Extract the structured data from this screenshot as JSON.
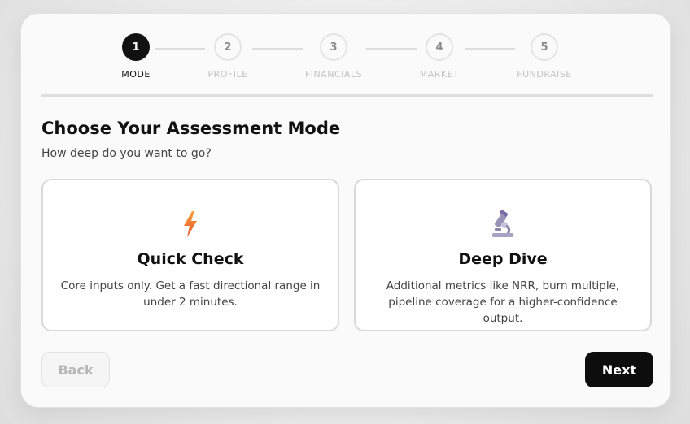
{
  "stepper": {
    "steps": [
      {
        "number": "1",
        "label": "MODE",
        "state": "active"
      },
      {
        "number": "2",
        "label": "PROFILE",
        "state": "inactive"
      },
      {
        "number": "3",
        "label": "FINANCIALS",
        "state": "inactive"
      },
      {
        "number": "4",
        "label": "MARKET",
        "state": "inactive"
      },
      {
        "number": "5",
        "label": "FUNDRAISE",
        "state": "inactive"
      }
    ]
  },
  "heading": {
    "title": "Choose Your Assessment Mode",
    "subtitle": "How deep do you want to go?"
  },
  "options": [
    {
      "icon": "lightning-bolt-icon",
      "title": "Quick Check",
      "description": "Core inputs only. Get a fast directional range in under 2 minutes."
    },
    {
      "icon": "microscope-icon",
      "title": "Deep Dive",
      "description": "Additional metrics like NRR, burn multiple, pipeline coverage for a higher-confidence output."
    }
  ],
  "actions": {
    "back_label": "Back",
    "next_label": "Next"
  },
  "colors": {
    "primary": "#111111",
    "inactive_text": "#c2c2c2",
    "border": "#d9d9d9",
    "bolt_orange": "#f07a2c"
  }
}
